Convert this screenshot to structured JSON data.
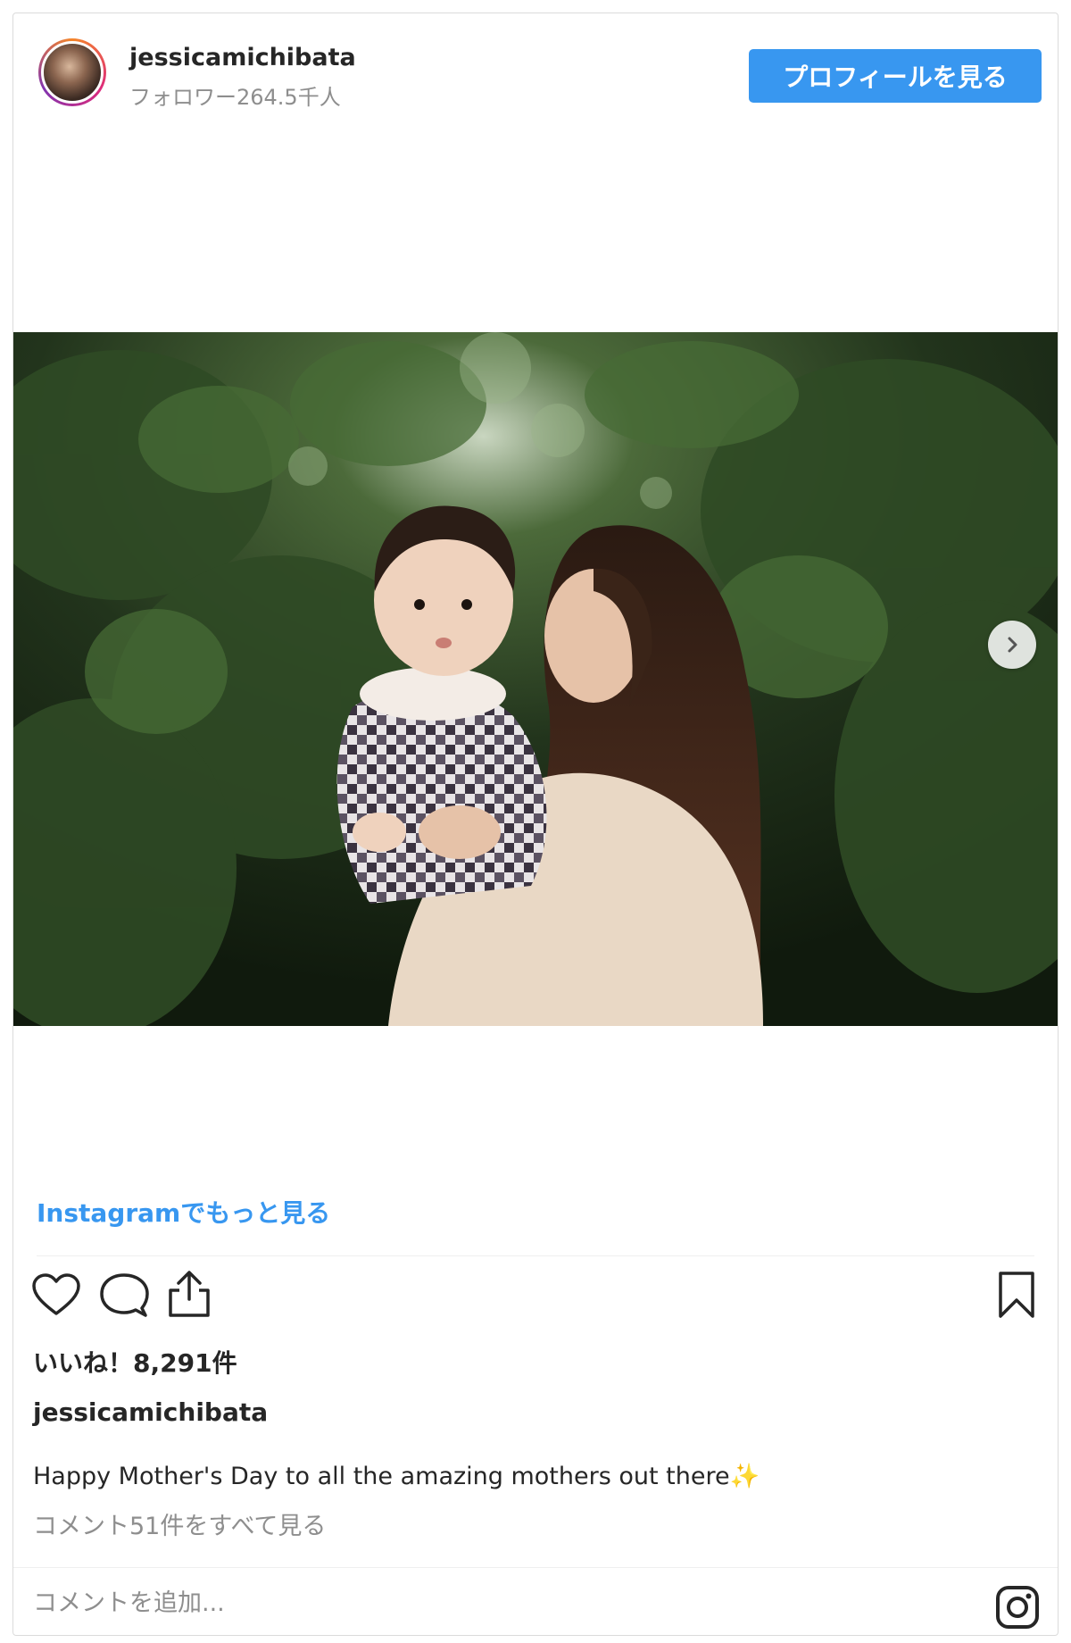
{
  "header": {
    "username": "jessicamichibata",
    "followers": "フォロワー264.5千人",
    "profile_button": "プロフィールを見る"
  },
  "photo": {
    "description": "mother-and-baby-photo",
    "next_icon": "chevron-right-icon"
  },
  "more_link": "Instagramでもっと見る",
  "actions": {
    "icons": [
      "heart-icon",
      "comment-icon",
      "share-icon",
      "bookmark-icon"
    ]
  },
  "likes": "いいね！8,291件",
  "caption": {
    "username": "jessicamichibata",
    "text": "Happy Mother's Day to all the amazing mothers out there✨"
  },
  "comments_link": "コメント51件をすべて見る",
  "comment_placeholder": "コメントを追加...",
  "colors": {
    "accent": "#3897f0",
    "muted": "#8e8e8e",
    "text": "#262626"
  }
}
